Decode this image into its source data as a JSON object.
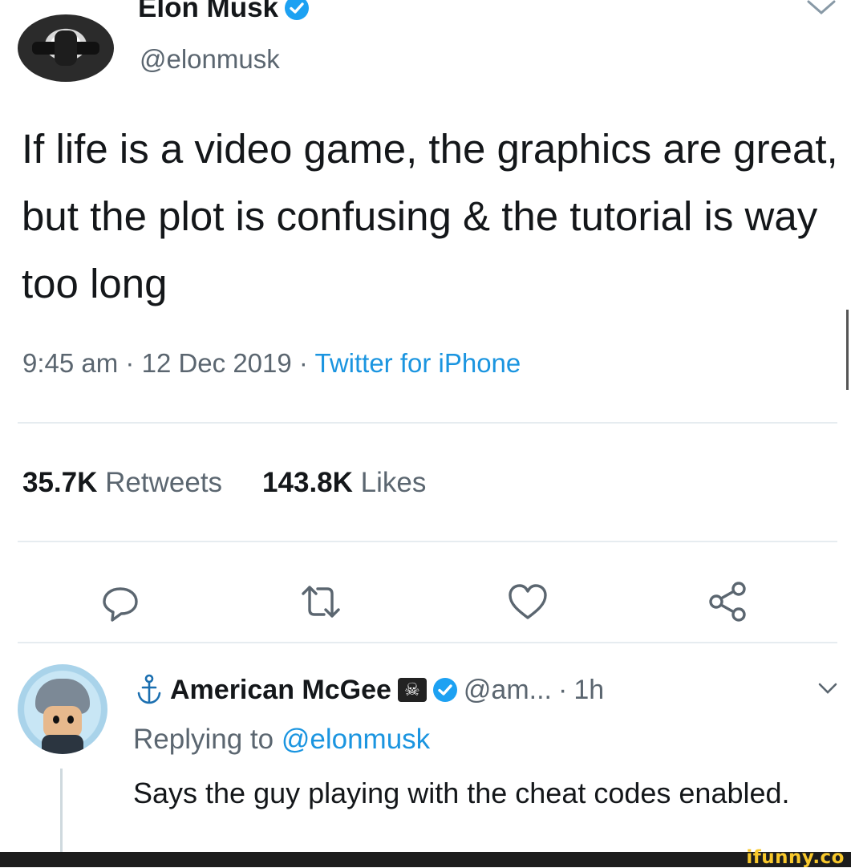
{
  "tweet": {
    "author_name": "Elon Musk",
    "author_handle": "@elonmusk",
    "text": "If life is a video game, the graphics are great, but the plot is confusing & the tutorial is way too long",
    "time": "9:45 am",
    "date": "12 Dec 2019",
    "separator": "·",
    "source": "Twitter for iPhone",
    "retweets_count": "35.7K",
    "retweets_label": "Retweets",
    "likes_count": "143.8K",
    "likes_label": "Likes"
  },
  "reply": {
    "author_name": "American McGee",
    "author_handle": "@am...",
    "separator": "·",
    "time": "1h",
    "replying_prefix": "Replying to",
    "replying_to": "@elonmusk",
    "text": "Says the guy playing with the cheat codes enabled."
  },
  "icons": {
    "verified": "verified-badge-icon",
    "reply": "reply-icon",
    "retweet": "retweet-icon",
    "like": "heart-icon",
    "share": "share-icon",
    "chevron": "chevron-down-icon",
    "anchor": "anchor-icon",
    "flag": "pirate-flag-icon"
  },
  "colors": {
    "text": "#14171a",
    "secondary": "#5b6670",
    "link": "#1b95e0",
    "verified": "#1da1f2",
    "divider": "#e6ecf0",
    "watermark": "#f8c82b"
  },
  "watermark": "ifunny.co"
}
